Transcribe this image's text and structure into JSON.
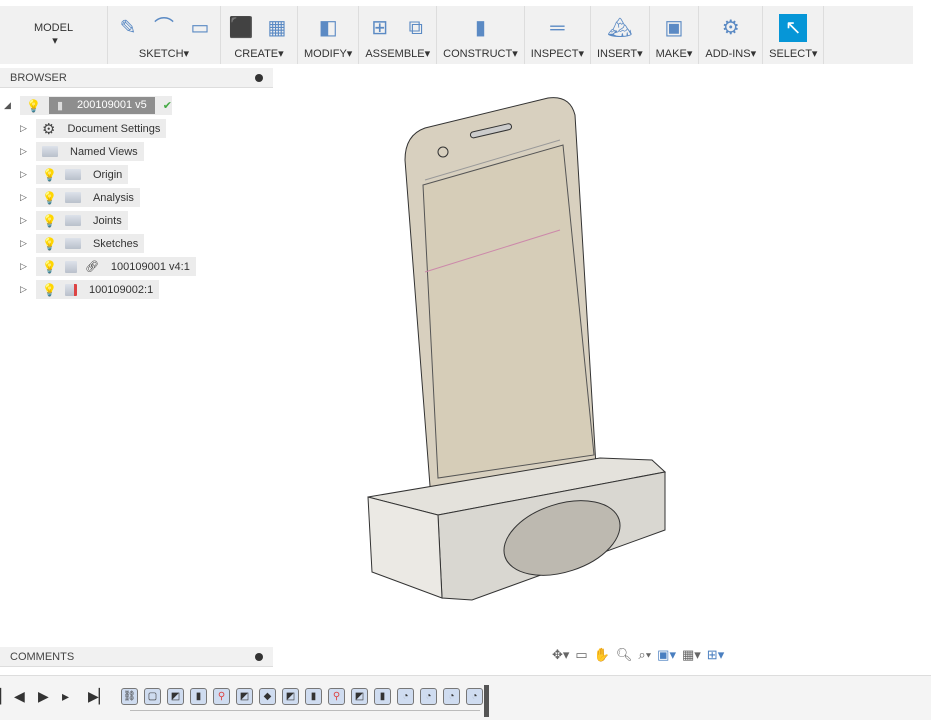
{
  "toolbar": {
    "workspace": "MODEL",
    "groups": [
      {
        "label": "SKETCH",
        "icons": [
          "create-sketch-icon",
          "arc-icon",
          "rectangle-icon"
        ]
      },
      {
        "label": "CREATE",
        "icons": [
          "extrude-icon",
          "form-icon"
        ]
      },
      {
        "label": "MODIFY",
        "icons": [
          "press-pull-icon"
        ]
      },
      {
        "label": "ASSEMBLE",
        "icons": [
          "new-component-icon",
          "joint-icon"
        ]
      },
      {
        "label": "CONSTRUCT",
        "icons": [
          "offset-plane-icon"
        ]
      },
      {
        "label": "INSPECT",
        "icons": [
          "measure-icon"
        ]
      },
      {
        "label": "INSERT",
        "icons": [
          "insert-image-icon"
        ]
      },
      {
        "label": "MAKE",
        "icons": [
          "3d-print-icon"
        ]
      },
      {
        "label": "ADD-INS",
        "icons": [
          "scripts-icon"
        ]
      },
      {
        "label": "SELECT",
        "icons": [
          "select-icon"
        ]
      }
    ],
    "accent": "#0696d7"
  },
  "browser": {
    "title": "BROWSER",
    "root": "200109001 v5",
    "items": [
      {
        "label": "Document Settings",
        "icon": "gear-icon",
        "bulb": false
      },
      {
        "label": "Named Views",
        "icon": "folder-icon",
        "bulb": false
      },
      {
        "label": "Origin",
        "icon": "folder-icon",
        "bulb": "blue"
      },
      {
        "label": "Analysis",
        "icon": "folder-icon",
        "bulb": "blue"
      },
      {
        "label": "Joints",
        "icon": "folder-icon",
        "bulb": "yellow"
      },
      {
        "label": "Sketches",
        "icon": "folder-icon",
        "bulb": "yellow"
      },
      {
        "label": "100109001 v4:1",
        "icon": "component-link-icon",
        "bulb": "yellow"
      },
      {
        "label": "100109002:1",
        "icon": "component-icon",
        "bulb": "yellow"
      }
    ]
  },
  "comments": {
    "title": "COMMENTS"
  },
  "timeline": {
    "items": [
      "link",
      "body",
      "sketch",
      "extrude",
      "joint",
      "sketch",
      "appearance",
      "sketch",
      "extrude",
      "joint",
      "sketch",
      "extrude",
      "fillet",
      "fillet",
      "fillet",
      "fillet"
    ]
  }
}
